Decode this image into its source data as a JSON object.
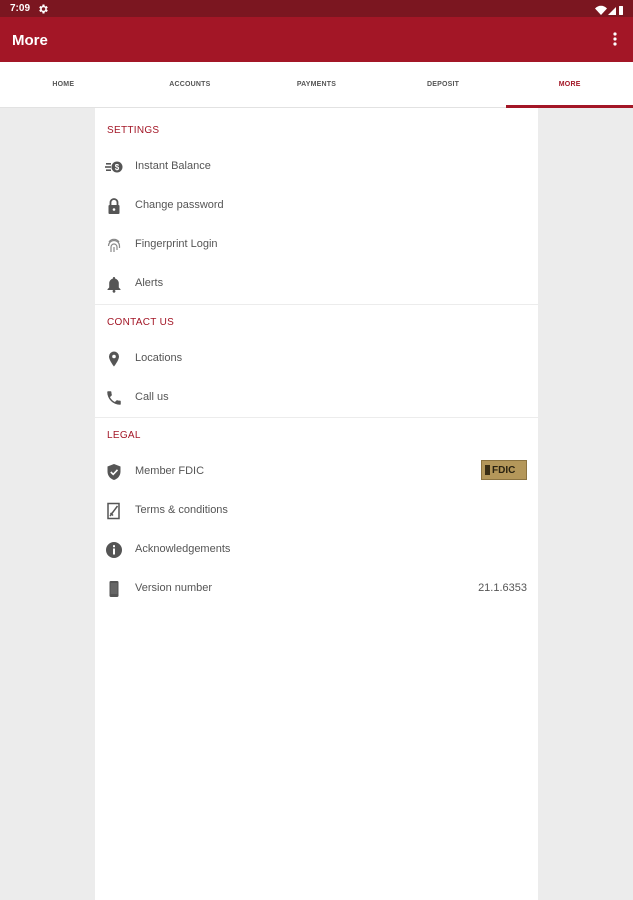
{
  "status_bar": {
    "time": "7:09"
  },
  "app_bar": {
    "title": "More"
  },
  "tabs": [
    {
      "label": "HOME"
    },
    {
      "label": "ACCOUNTS"
    },
    {
      "label": "PAYMENTS"
    },
    {
      "label": "DEPOSIT"
    },
    {
      "label": "MORE",
      "active": true
    }
  ],
  "sections": {
    "settings": {
      "header": "SETTINGS",
      "items": [
        {
          "label": "Instant Balance",
          "icon": "instant-balance-icon"
        },
        {
          "label": "Change password",
          "icon": "lock-icon"
        },
        {
          "label": "Fingerprint Login",
          "icon": "fingerprint-icon"
        },
        {
          "label": "Alerts",
          "icon": "bell-icon"
        }
      ]
    },
    "contact": {
      "header": "CONTACT US",
      "items": [
        {
          "label": "Locations",
          "icon": "location-pin-icon"
        },
        {
          "label": "Call us",
          "icon": "phone-icon"
        }
      ]
    },
    "legal": {
      "header": "LEGAL",
      "items": [
        {
          "label": "Member FDIC",
          "icon": "shield-check-icon",
          "badge": "FDIC"
        },
        {
          "label": "Terms & conditions",
          "icon": "document-icon"
        },
        {
          "label": "Acknowledgements",
          "icon": "info-icon"
        },
        {
          "label": "Version number",
          "icon": "phone-device-icon",
          "value": "21.1.6353"
        }
      ]
    }
  },
  "colors": {
    "brand": "#a31626",
    "status_bar": "#7b1620",
    "text": "#555555",
    "background": "#ececec"
  }
}
